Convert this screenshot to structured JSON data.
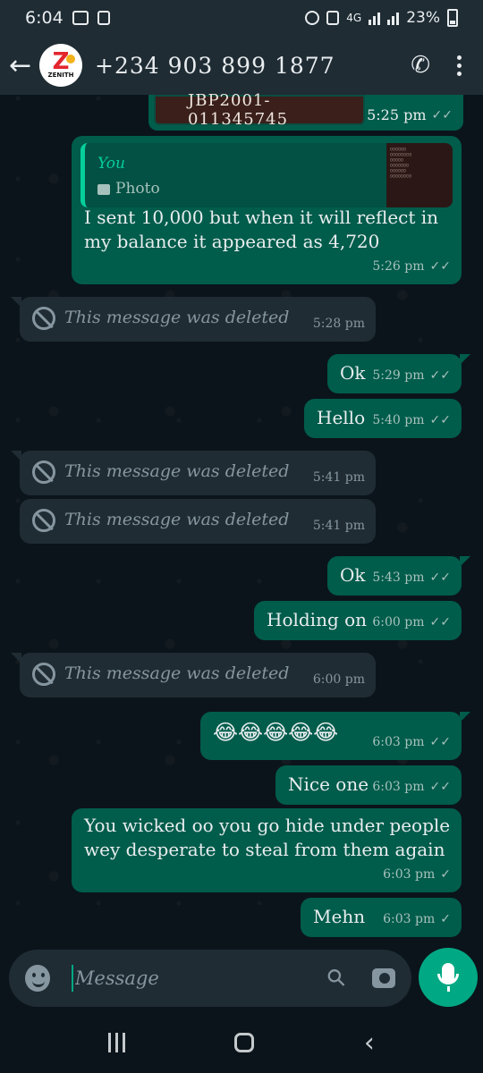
{
  "status_bar": {
    "time": "6:04",
    "network": "4G",
    "battery": "23%"
  },
  "header": {
    "contact": "+234 903 899 1877",
    "avatar_label": "ZENITH",
    "avatar_letter": "Z"
  },
  "top_fragment": {
    "text": "JBP2001-011345745",
    "time": "5:25 pm"
  },
  "messages": [
    {
      "id": "reply",
      "quote_author": "You",
      "quote_kind": "Photo",
      "line1": "I sent 10,000 but when it will reflect in",
      "line2": "my balance it appeared as 4,720",
      "time": "5:26 pm"
    },
    {
      "id": "d1",
      "text": "This message was deleted",
      "time": "5:28 pm"
    },
    {
      "id": "m1",
      "text": "Ok",
      "time": "5:29 pm"
    },
    {
      "id": "m2",
      "text": "Hello",
      "time": "5:40 pm"
    },
    {
      "id": "d2",
      "text": "This message was deleted",
      "time": "5:41 pm"
    },
    {
      "id": "d3",
      "text": "This message was deleted",
      "time": "5:41 pm"
    },
    {
      "id": "m3",
      "text": "Ok",
      "time": "5:43 pm"
    },
    {
      "id": "m4",
      "text": "Holding on",
      "time": "6:00 pm"
    },
    {
      "id": "d4",
      "text": "This message was deleted",
      "time": "6:00 pm"
    },
    {
      "id": "m5",
      "text": "😂😂😂😂😂",
      "time": "6:03 pm"
    },
    {
      "id": "m6",
      "text": "Nice one",
      "time": "6:03 pm"
    },
    {
      "id": "m7",
      "line1": "You wicked oo you go hide under people",
      "line2": "wey desperate to steal from them again",
      "time": "6:03 pm"
    },
    {
      "id": "m8",
      "text": "Mehn",
      "time": "6:03 pm"
    }
  ],
  "ticks": {
    "read": "✓✓",
    "sent": "✓"
  },
  "input": {
    "placeholder": "Message"
  },
  "colors": {
    "outgoing": "#005c4b",
    "incoming": "#202c33",
    "accent": "#00a884"
  }
}
